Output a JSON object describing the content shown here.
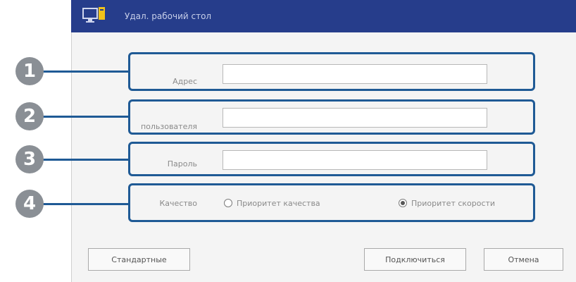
{
  "window": {
    "title": "Удал. рабочий стол",
    "icon": "remote-desktop-icon"
  },
  "form": {
    "address_label": "Адрес",
    "address_value": "",
    "username_label": "пользователя",
    "username_value": "",
    "password_label": "Пароль",
    "password_value": "",
    "quality_label": "Качество",
    "quality_options": [
      "Приоритет качества",
      "Приоритет скорости"
    ],
    "quality_selected": "Приоритет скорости"
  },
  "callouts": [
    "1",
    "2",
    "3",
    "4"
  ],
  "buttons": {
    "defaults": "Стандартные",
    "connect": "Подключиться",
    "cancel": "Отмена"
  },
  "colors": {
    "titlebar": "#263d8b",
    "callout_border": "#1f5a95",
    "badge": "#8a8f95"
  }
}
